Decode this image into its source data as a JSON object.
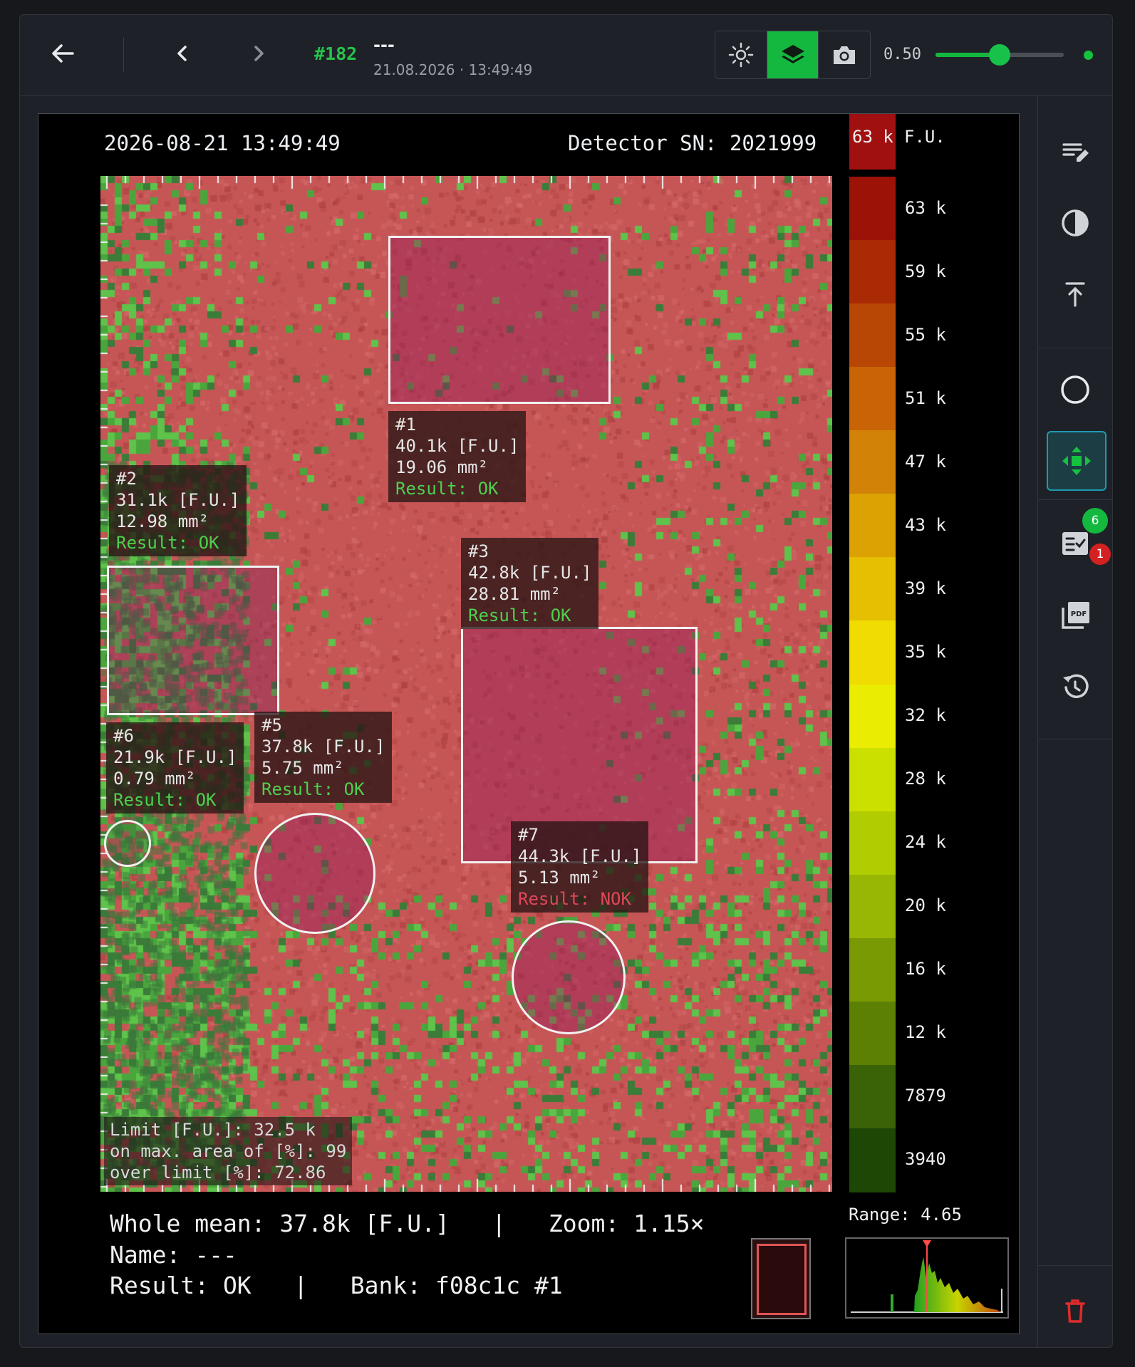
{
  "toolbar": {
    "record_id": "#182",
    "record_name": "---",
    "record_datetime": "21.08.2026 · 13:49:49",
    "opacity_value": "0.50",
    "opacity_fraction": 0.5,
    "accent_color": "#15b83f"
  },
  "icons": {
    "back": "arrow-left-icon",
    "prev": "chevron-left-icon",
    "next": "chevron-right-icon",
    "brightness": "brightness-icon",
    "layers": "layers-icon",
    "camera": "camera-icon",
    "edit_notes": "edit-notes-icon",
    "contrast": "contrast-icon",
    "align_top": "align-top-icon",
    "circle": "circle-icon",
    "move": "move-icon",
    "checklist": "checklist-icon",
    "pdf": "pdf-icon",
    "history": "history-icon",
    "delete": "trash-icon"
  },
  "sidebar": {
    "checklist_ok_count": "6",
    "checklist_nok_count": "1"
  },
  "viewer": {
    "timestamp": "2026-08-21 13:49:49",
    "detector": "Detector SN: 2021999",
    "scale_max_label": "63 k",
    "unit": "F.U.",
    "scale_labels": [
      "63 k",
      "59 k",
      "55 k",
      "51 k",
      "47 k",
      "43 k",
      "39 k",
      "35 k",
      "32 k",
      "28 k",
      "24 k",
      "20 k",
      "16 k",
      "12 k",
      "7879",
      "3940"
    ],
    "scale_colors": [
      "#9c1206",
      "#aa2a04",
      "#b84604",
      "#c86406",
      "#d28206",
      "#dca204",
      "#e6be02",
      "#f0dc00",
      "#eaec02",
      "#cce000",
      "#b2cc02",
      "#98b604",
      "#7a9a04",
      "#5c8004",
      "#3a6206",
      "#1e4604"
    ],
    "rois": [
      {
        "id": "#1",
        "value": "40.1k [F.U.]",
        "area": "19.06 mm²",
        "result": "Result: OK",
        "status": "ok"
      },
      {
        "id": "#2",
        "value": "31.1k [F.U.]",
        "area": "12.98 mm²",
        "result": "Result: OK",
        "status": "ok"
      },
      {
        "id": "#3",
        "value": "42.8k [F.U.]",
        "area": "28.81 mm²",
        "result": "Result: OK",
        "status": "ok"
      },
      {
        "id": "#5",
        "value": "37.8k [F.U.]",
        "area": "5.75 mm²",
        "result": "Result: OK",
        "status": "ok"
      },
      {
        "id": "#6",
        "value": "21.9k [F.U.]",
        "area": "0.79 mm²",
        "result": "Result: OK",
        "status": "ok"
      },
      {
        "id": "#7",
        "value": "44.3k [F.U.]",
        "area": "5.13 mm²",
        "result": "Result: NOK",
        "status": "nok"
      }
    ],
    "limit": {
      "line1": "Limit [F.U.]: 32.5 k",
      "line2": "on max. area of [%]: 99",
      "line3": "over limit [%]: 72.86"
    },
    "footer": {
      "line1": "Whole mean: 37.8k [F.U.]   |   Zoom: 1.15×",
      "line2": "Name: ---",
      "line3": "Result: OK   |   Bank: f08c1c #1"
    },
    "range_label": "Range: 4.65"
  }
}
